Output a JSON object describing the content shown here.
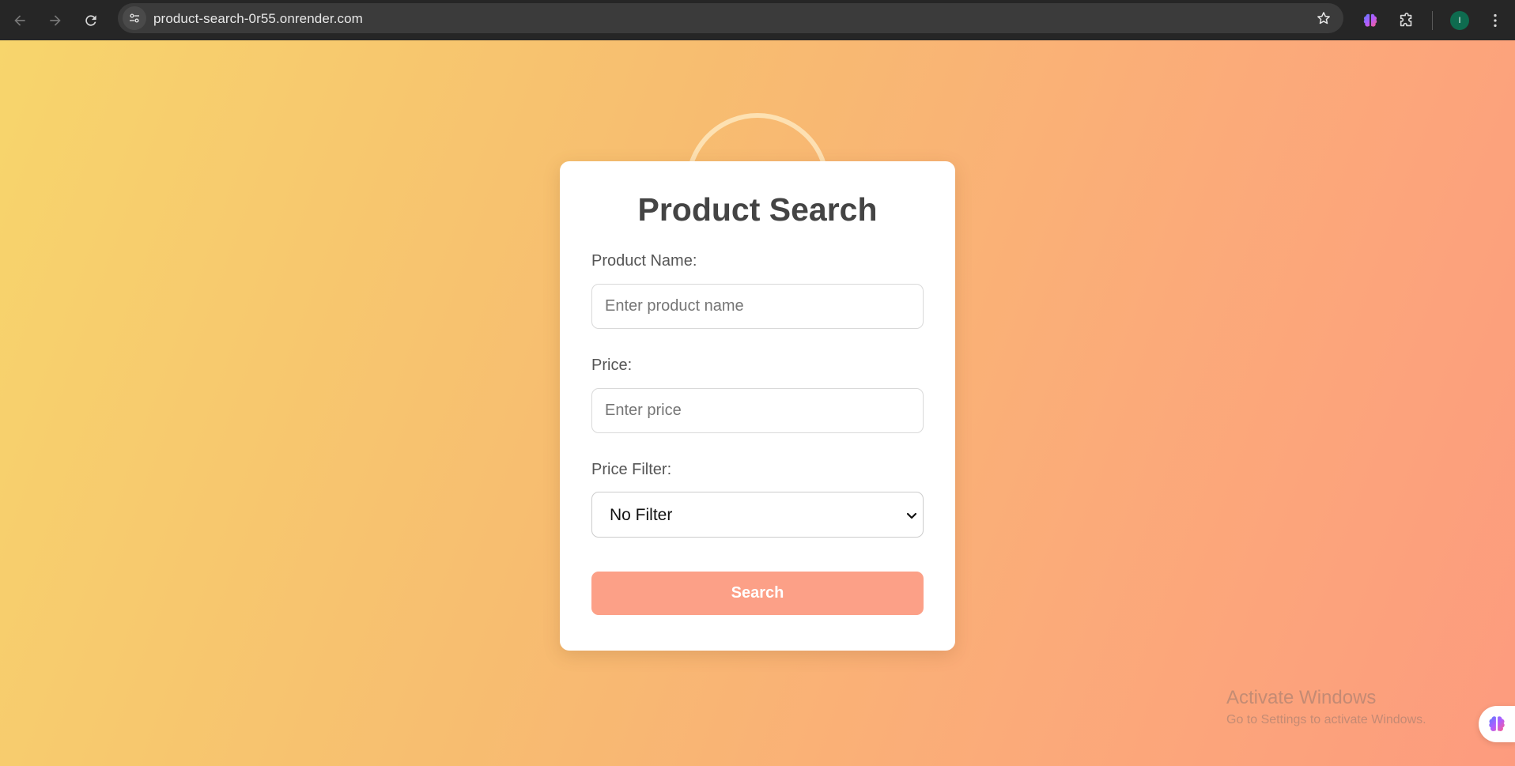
{
  "browser": {
    "url": "product-search-0r55.onrender.com",
    "profile_initial": "I",
    "icons": {
      "back": "arrow-left-icon",
      "forward": "arrow-right-icon",
      "reload": "reload-icon",
      "site_info": "tune-icon",
      "bookmark": "star-icon",
      "extension": "brain-icon",
      "extensions_menu": "puzzle-icon",
      "menu": "kebab-icon"
    }
  },
  "form": {
    "title": "Product Search",
    "product_name": {
      "label": "Product Name:",
      "placeholder": "Enter product name",
      "value": ""
    },
    "price": {
      "label": "Price:",
      "placeholder": "Enter price",
      "value": ""
    },
    "price_filter": {
      "label": "Price Filter:",
      "selected": "No Filter"
    },
    "search_label": "Search"
  },
  "watermark": {
    "title": "Activate Windows",
    "subtitle": "Go to Settings to activate Windows."
  },
  "colors": {
    "gradient_start": "#f7d56c",
    "gradient_end": "#fd9b7e",
    "button": "#fca087",
    "title_text": "#444444"
  }
}
